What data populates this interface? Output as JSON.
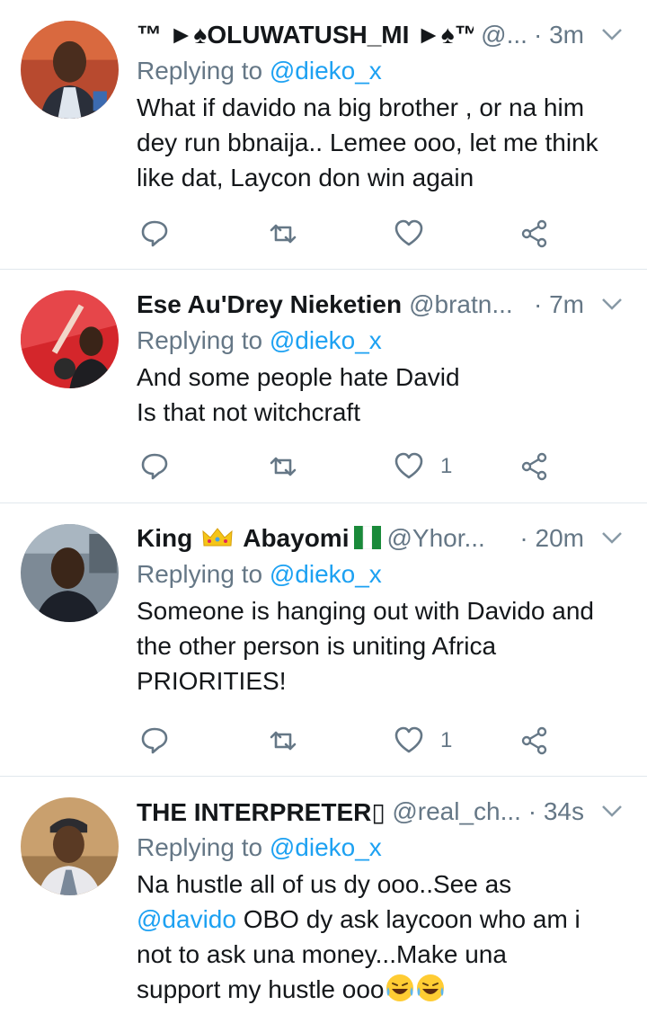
{
  "reply_prefix": "Replying to",
  "tweets": [
    {
      "name": "™ ►♠OLUWATUSH_MI ►♠™",
      "handle": "@...",
      "time": "· 3m",
      "replying_to": "@dieko_x",
      "body_lines": [
        "What if davido na big brother , or na him",
        "dey run bbnaija.. Lemee ooo, let me think",
        "like dat, Laycon don win again"
      ],
      "likes": ""
    },
    {
      "name": "Ese Au'Drey Nieketien",
      "handle": "@bratn...",
      "time": "· 7m",
      "replying_to": "@dieko_x",
      "body_lines": [
        "And some people hate David",
        "Is that not witchcraft"
      ],
      "likes": "1"
    },
    {
      "name_part1": "King",
      "name_part2": "Abayomi",
      "handle": "@Yhor...",
      "time": "· 20m",
      "replying_to": "@dieko_x",
      "body_lines": [
        "Someone is hanging out with Davido and",
        "the other person is uniting Africa",
        "PRIORITIES!"
      ],
      "likes": "1"
    },
    {
      "name": "THE INTERPRETER▯",
      "handle": "@real_ch...",
      "time": "· 34s",
      "replying_to": "@dieko_x",
      "body_mention": "@davido",
      "body_line1": "Na hustle all of us dy ooo..See as",
      "body_line2_rest": " OBO dy ask laycoon who am i",
      "body_line3": "not to ask una money...Make una",
      "body_line4": "support my hustle ooo",
      "likes": ""
    }
  ],
  "icons": {
    "reply": "reply-icon",
    "retweet": "retweet-icon",
    "like": "heart-icon",
    "share": "share-icon",
    "menu": "chevron-down-icon"
  },
  "colors": {
    "link": "#1da1f2",
    "muted": "#657786",
    "divider": "#e1e8ed"
  }
}
